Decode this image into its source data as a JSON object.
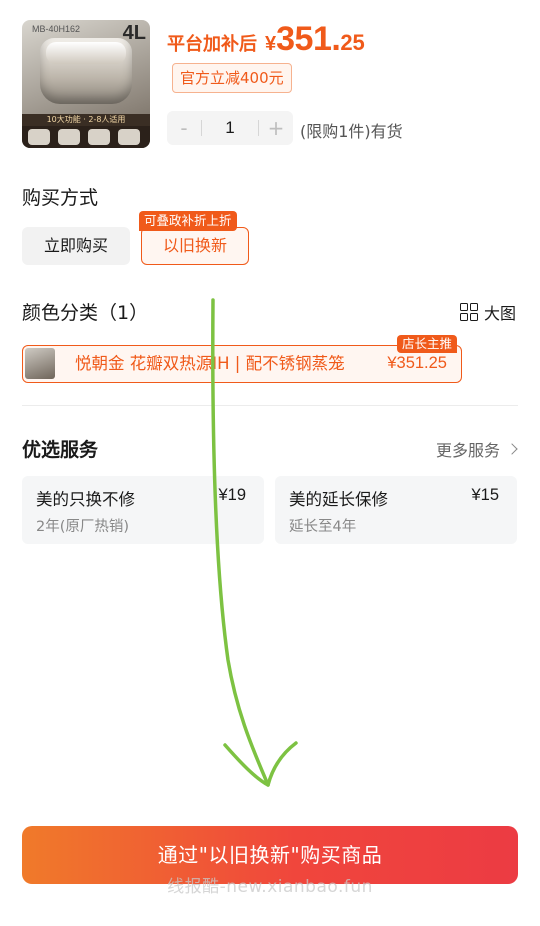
{
  "product": {
    "thumb_model": "MB-40H162",
    "thumb_capacity": "4L",
    "thumb_band": "10大功能 · 2-8人适用"
  },
  "price": {
    "label": "平台加补后",
    "currency": "¥",
    "integer": "351.",
    "decimal": "25"
  },
  "discount_tag": "官方立减400元",
  "stepper": {
    "minus": "-",
    "quantity": "1",
    "plus": "+"
  },
  "stock_text": "(限购1件)有货",
  "purchase_method": {
    "title": "购买方式",
    "options": [
      "立即购买",
      "以旧换新"
    ],
    "trade_in_badge": "可叠政补折上折",
    "selected": "以旧换新"
  },
  "color": {
    "title": "颜色分类（1）",
    "big_view_label": "大图",
    "variant_name": "悦朝金 花瓣双热源IH | 配不锈钢蒸笼",
    "variant_price": "¥351.25",
    "variant_badge": "店长主推"
  },
  "services": {
    "title": "优选服务",
    "more_label": "更多服务",
    "items": [
      {
        "name": "美的只换不修",
        "price": "¥19",
        "desc": "2年(原厂热销)"
      },
      {
        "name": "美的延长保修",
        "price": "¥15",
        "desc": "延长至4年"
      }
    ]
  },
  "cta_label": "通过\"以旧换新\"购买商品",
  "watermark": "线报酷-new.xianbao.fun",
  "colors": {
    "accent": "#f05a1a",
    "cta_start": "#f07a2a",
    "cta_end": "#ec3b43",
    "annotation_arrow": "#7dc242"
  },
  "icons": [
    "grid-icon",
    "chevron-right-icon"
  ]
}
